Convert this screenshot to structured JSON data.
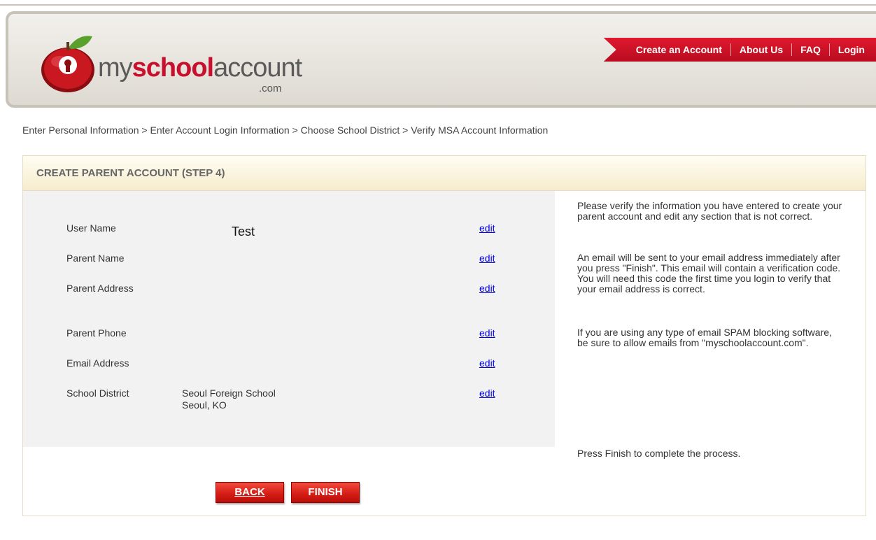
{
  "brand": {
    "part1": "my",
    "part2": "school",
    "part3": "account",
    "suffix": ".com",
    "reflection": "myschoolaccount"
  },
  "nav": {
    "items": [
      "Create an Account",
      "About Us",
      "FAQ",
      "Login"
    ]
  },
  "breadcrumb": "Enter Personal Information > Enter Account Login Information > Choose School District > Verify MSA Account Information",
  "panel": {
    "title": "CREATE PARENT ACCOUNT (STEP 4)",
    "fields": [
      {
        "label": "User Name",
        "value": "Test",
        "edit": "edit"
      },
      {
        "label": "Parent Name",
        "value": "",
        "edit": "edit"
      },
      {
        "label": "Parent Address",
        "value": "",
        "edit": "edit"
      },
      {
        "label": "Parent Phone",
        "value": "",
        "edit": "edit"
      },
      {
        "label": "Email Address",
        "value": "",
        "edit": "edit"
      },
      {
        "label": "School District",
        "value_line1": "Seoul Foreign School",
        "value_line2": "Seoul, KO",
        "edit": "edit"
      }
    ],
    "help": {
      "p1": "Please verify the information you have entered to create your parent account and edit any section that is not correct.",
      "p2": "An email will be sent to your email address immediately after you press \"Finish\". This email will contain a verification code. You will need this code the first time you login to verify that your email address is correct.",
      "p3": "If you are using any type of email SPAM blocking software, be sure to allow emails from \"myschoolaccount.com\".",
      "p4": "Press Finish to complete the process."
    },
    "buttons": {
      "back": "BACK",
      "finish": "FINISH"
    }
  },
  "colors": {
    "brand_red": "#c8102e",
    "link": "#0000ee",
    "panel_bg": "#f2f2f2"
  }
}
